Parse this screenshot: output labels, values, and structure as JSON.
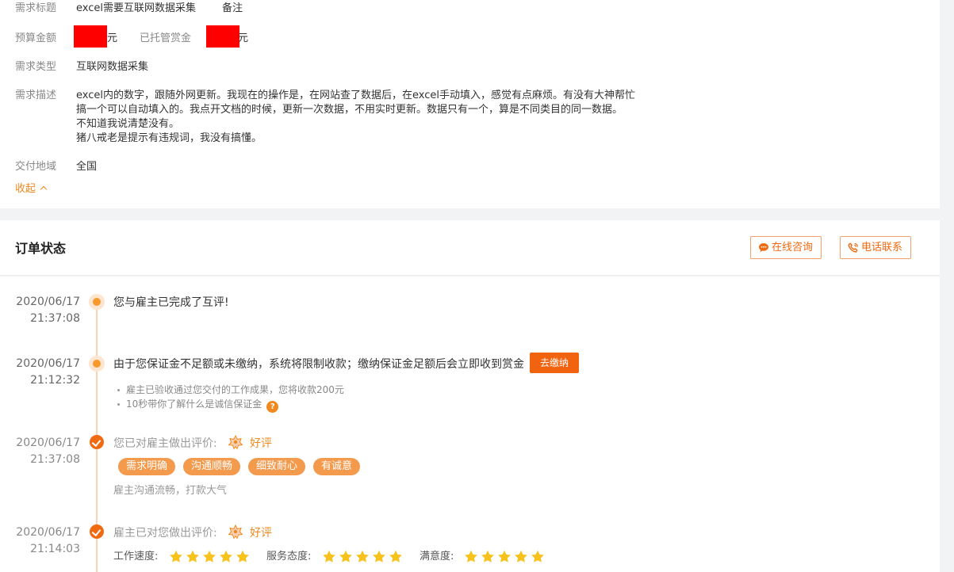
{
  "requirement": {
    "title_label": "需求标题",
    "title_value": "excel需要互联网数据采集",
    "note_label": "备注",
    "budget_label": "预算金额",
    "budget_unit": "元",
    "escrow_label": "已托管赏金",
    "escrow_unit": "元",
    "type_label": "需求类型",
    "type_value": "互联网数据采集",
    "desc_label": "需求描述",
    "desc_lines": [
      "excel内的数字，跟随外网更新。我现在的操作是，在网站查了数据后，在excel手动填入，感觉有点麻烦。有没有大神帮忙",
      "搞一个可以自动填入的。我点开文档的时候，更新一次数据，不用实时更新。数据只有一个，算是不同类目的同一数据。",
      "不知道我说清楚没有。",
      "猪八戒老是提示有违规词，我没有搞懂。"
    ],
    "region_label": "交付地域",
    "region_value": "全国",
    "collapse_label": "收起",
    "redaction_color": "#ff0000"
  },
  "order_status": {
    "title": "订单状态",
    "online_consult": "在线咨询",
    "phone_contact": "电话联系"
  },
  "timeline": [
    {
      "date": "2020/06/17",
      "time": "21:37:08",
      "text": "您与雇主已完成了互评!"
    },
    {
      "date": "2020/06/17",
      "time": "21:12:32",
      "text": "由于您保证金不足额或未缴纳，系统将限制收款；缴纳保证金足额后会立即收到赏金",
      "button": "去缴纳",
      "bullets": [
        "雇主已验收通过您交付的工作成果，您将收款200元",
        "10秒带你了解什么是诚信保证金"
      ],
      "help_icon": "?"
    },
    {
      "date": "2020/06/17",
      "time": "21:37:08",
      "text": "您已对雇主做出评价:",
      "rating": "好评",
      "tags": [
        "需求明确",
        "沟通顺畅",
        "细致耐心",
        "有诚意"
      ],
      "comment": "雇主沟通流畅，打款大气"
    },
    {
      "date": "2020/06/17",
      "time": "21:14:03",
      "text": "雇主已对您做出评价:",
      "rating": "好评",
      "scores": [
        {
          "label": "工作速度:",
          "stars": 5
        },
        {
          "label": "服务态度:",
          "stars": 5
        },
        {
          "label": "满意度:",
          "stars": 5
        }
      ]
    }
  ],
  "colors": {
    "accent": "#f06a12",
    "tag_bg": "#f49a4d",
    "star": "#f7c21b",
    "timeline_line": "#fbd3b0"
  }
}
